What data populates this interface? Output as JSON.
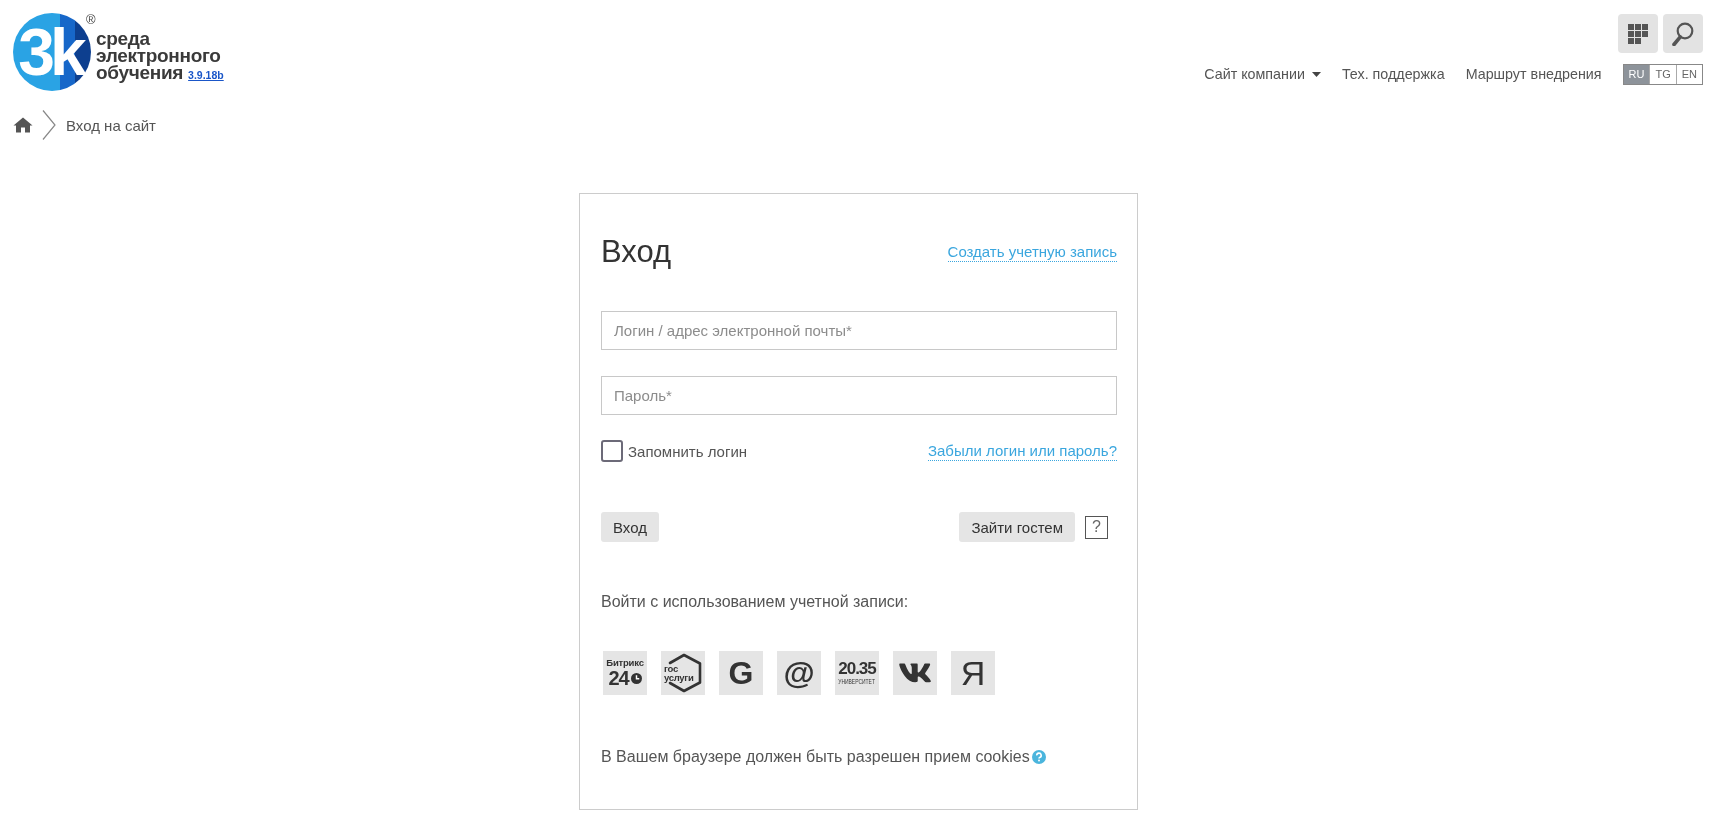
{
  "header": {
    "logo": {
      "mark": "3k",
      "registered_mark": "®",
      "lines": [
        "среда",
        "электронного",
        "обучения"
      ],
      "version": "3.9.18b"
    },
    "nav": [
      {
        "label": "Сайт компании",
        "dropdown": true
      },
      {
        "label": "Тех. поддержка",
        "dropdown": false
      },
      {
        "label": "Маршрут внедрения",
        "dropdown": false
      }
    ],
    "languages": [
      {
        "label": "RU",
        "selected": true
      },
      {
        "label": "TG",
        "selected": false
      },
      {
        "label": "EN",
        "selected": false
      }
    ]
  },
  "breadcrumb": {
    "items": [
      "Вход на сайт"
    ]
  },
  "login_form": {
    "title": "Вход",
    "create_account_link": "Создать учетную запись",
    "fields": [
      {
        "placeholder": "Логин / адрес электронной почты*"
      },
      {
        "placeholder": "Пароль*"
      }
    ],
    "remember": {
      "label": "Запомнить логин",
      "checked": false
    },
    "forgot_link": "Забыли логин или пароль?",
    "buttons": [
      {
        "kind": "primary",
        "label": "Вход"
      },
      {
        "kind": "guest",
        "label": "Зайти гостем"
      },
      {
        "kind": "help",
        "label": "?"
      }
    ],
    "social_heading": "Войти с использованием учетной записи:",
    "social_logins": [
      {
        "kind": "bitrix",
        "lines": [
          "Битрикс",
          "24"
        ]
      },
      {
        "kind": "gosuslugi",
        "lines": [
          "гос",
          "услуги"
        ]
      },
      {
        "kind": "google",
        "lines": [
          "G"
        ]
      },
      {
        "kind": "mail",
        "lines": [
          "@"
        ]
      },
      {
        "kind": "university",
        "lines": [
          "20.35",
          "УНИВЕРСИТЕТ"
        ]
      },
      {
        "kind": "vk"
      },
      {
        "kind": "yandex",
        "lines": [
          "Я"
        ]
      }
    ],
    "cookie_note": "В Вашем браузере должен быть разрешен прием cookies"
  }
}
